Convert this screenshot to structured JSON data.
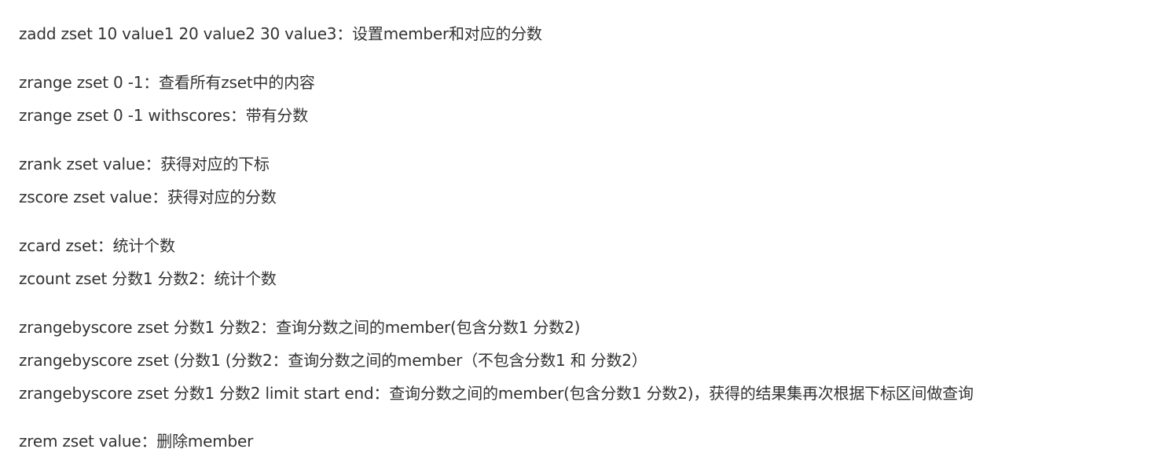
{
  "groups": [
    {
      "lines": [
        "zadd zset 10 value1 20 value2 30 value3：设置member和对应的分数"
      ]
    },
    {
      "lines": [
        "zrange zset 0 -1：查看所有zset中的内容",
        "zrange zset 0 -1 withscores：带有分数"
      ]
    },
    {
      "lines": [
        "zrank zset value：获得对应的下标",
        "zscore zset value：获得对应的分数"
      ]
    },
    {
      "lines": [
        "zcard zset：统计个数",
        "zcount zset 分数1 分数2：统计个数"
      ]
    },
    {
      "lines": [
        "zrangebyscore zset 分数1 分数2：查询分数之间的member(包含分数1 分数2)",
        "zrangebyscore zset (分数1 (分数2：查询分数之间的member（不包含分数1 和 分数2）",
        "zrangebyscore zset 分数1 分数2 limit start end：查询分数之间的member(包含分数1 分数2)，获得的结果集再次根据下标区间做查询"
      ]
    },
    {
      "lines": [
        "zrem zset value：删除member"
      ]
    }
  ]
}
